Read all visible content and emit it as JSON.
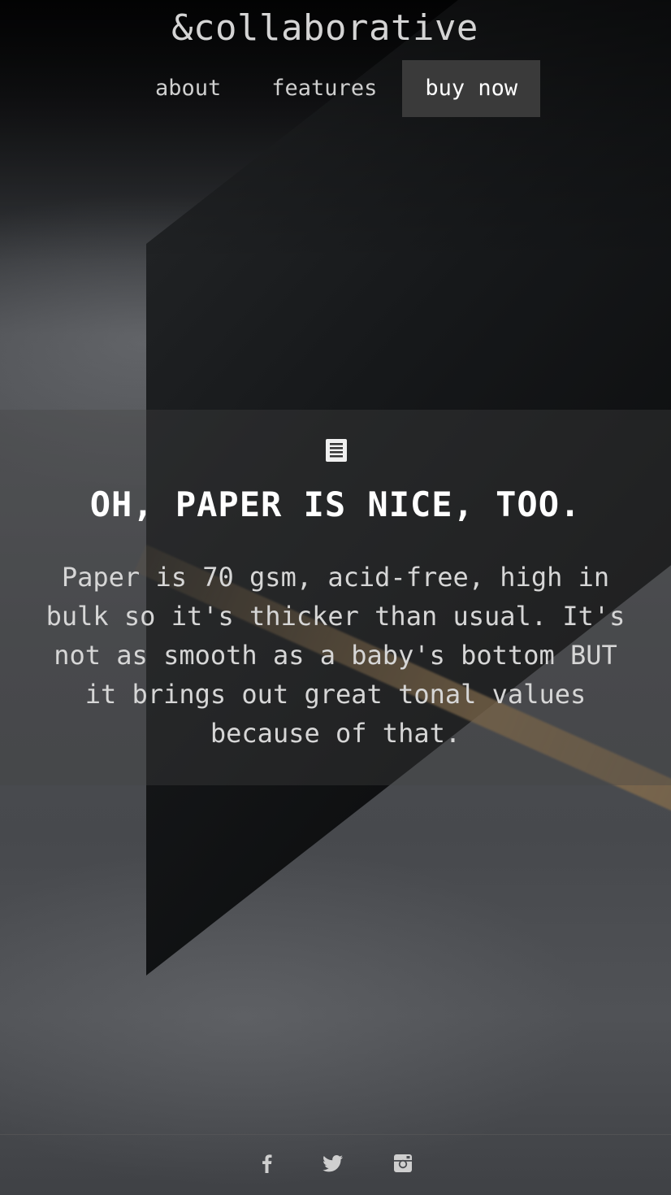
{
  "header": {
    "site_title": "&collaborative",
    "nav": [
      {
        "label": "about"
      },
      {
        "label": "features"
      },
      {
        "label": "buy now"
      }
    ]
  },
  "feature": {
    "icon": "document-icon",
    "title": "OH, PAPER IS NICE, TOO.",
    "text": "Paper is 70 gsm, acid-free, high in bulk so it's thicker than usual. It's not as smooth as a baby's bottom BUT it brings out great tonal values because of that."
  },
  "footer": {
    "social": [
      {
        "icon": "facebook-icon"
      },
      {
        "icon": "twitter-icon"
      },
      {
        "icon": "instagram-icon"
      }
    ]
  },
  "colors": {
    "nav_active_bg": "#3a3a3a",
    "text": "#d6d6d6",
    "title": "#ffffff"
  }
}
